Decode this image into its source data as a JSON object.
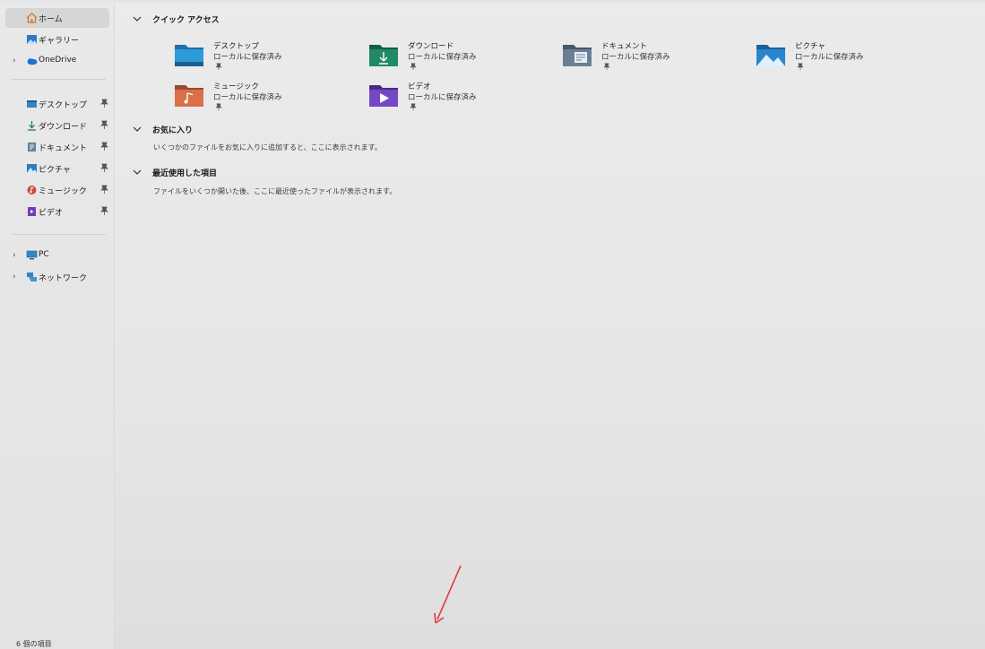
{
  "sidebar": {
    "items": [
      {
        "label": "ホーム",
        "icon": "home-icon",
        "selected": true
      },
      {
        "label": "ギャラリー",
        "icon": "gallery-icon"
      },
      {
        "label": "OneDrive",
        "icon": "onedrive-cloud-icon",
        "expandable": true
      },
      {
        "label": "デスクトップ",
        "icon": "desktop-folder-icon",
        "pinned": true
      },
      {
        "label": "ダウンロード",
        "icon": "download-icon",
        "pinned": true
      },
      {
        "label": "ドキュメント",
        "icon": "document-icon",
        "pinned": true
      },
      {
        "label": "ピクチャ",
        "icon": "pictures-icon",
        "pinned": true
      },
      {
        "label": "ミュージック",
        "icon": "music-icon",
        "pinned": true
      },
      {
        "label": "ビデオ",
        "icon": "video-icon",
        "pinned": true
      },
      {
        "label": "PC",
        "icon": "pc-monitor-icon",
        "expandable": true
      },
      {
        "label": "ネットワーク",
        "icon": "network-icon",
        "expandable": true
      }
    ]
  },
  "quick_access": {
    "title": "クイック アクセス",
    "tiles": [
      {
        "name": "デスクトップ",
        "sub": "ローカルに保存済み",
        "icon": "desktop-folder-icon",
        "color": "#2f86c8"
      },
      {
        "name": "ダウンロード",
        "sub": "ローカルに保存済み",
        "icon": "downloads-folder-icon",
        "color": "#1c7a5a"
      },
      {
        "name": "ドキュメント",
        "sub": "ローカルに保存済み",
        "icon": "documents-folder-icon",
        "color": "#5a6f86"
      },
      {
        "name": "ピクチャ",
        "sub": "ローカルに保存済み",
        "icon": "pictures-folder-icon",
        "color": "#2a7ec2"
      },
      {
        "name": "ミュージック",
        "sub": "ローカルに保存済み",
        "icon": "music-folder-icon",
        "color": "#c8603a"
      },
      {
        "name": "ビデオ",
        "sub": "ローカルに保存済み",
        "icon": "videos-folder-icon",
        "color": "#6d3fb8"
      }
    ]
  },
  "favorites": {
    "title": "お気に入り",
    "description": "いくつかのファイルをお気に入りに追加すると、ここに表示されます。"
  },
  "recent": {
    "title": "最近使用した項目",
    "description": "ファイルをいくつか開いた後、ここに最近使ったファイルが表示されます。"
  },
  "status_bar": {
    "item_count": "6 個の項目"
  },
  "colors": {
    "annotation_arrow": "#e23a3a",
    "selected_bg": "#d6d6d6"
  }
}
